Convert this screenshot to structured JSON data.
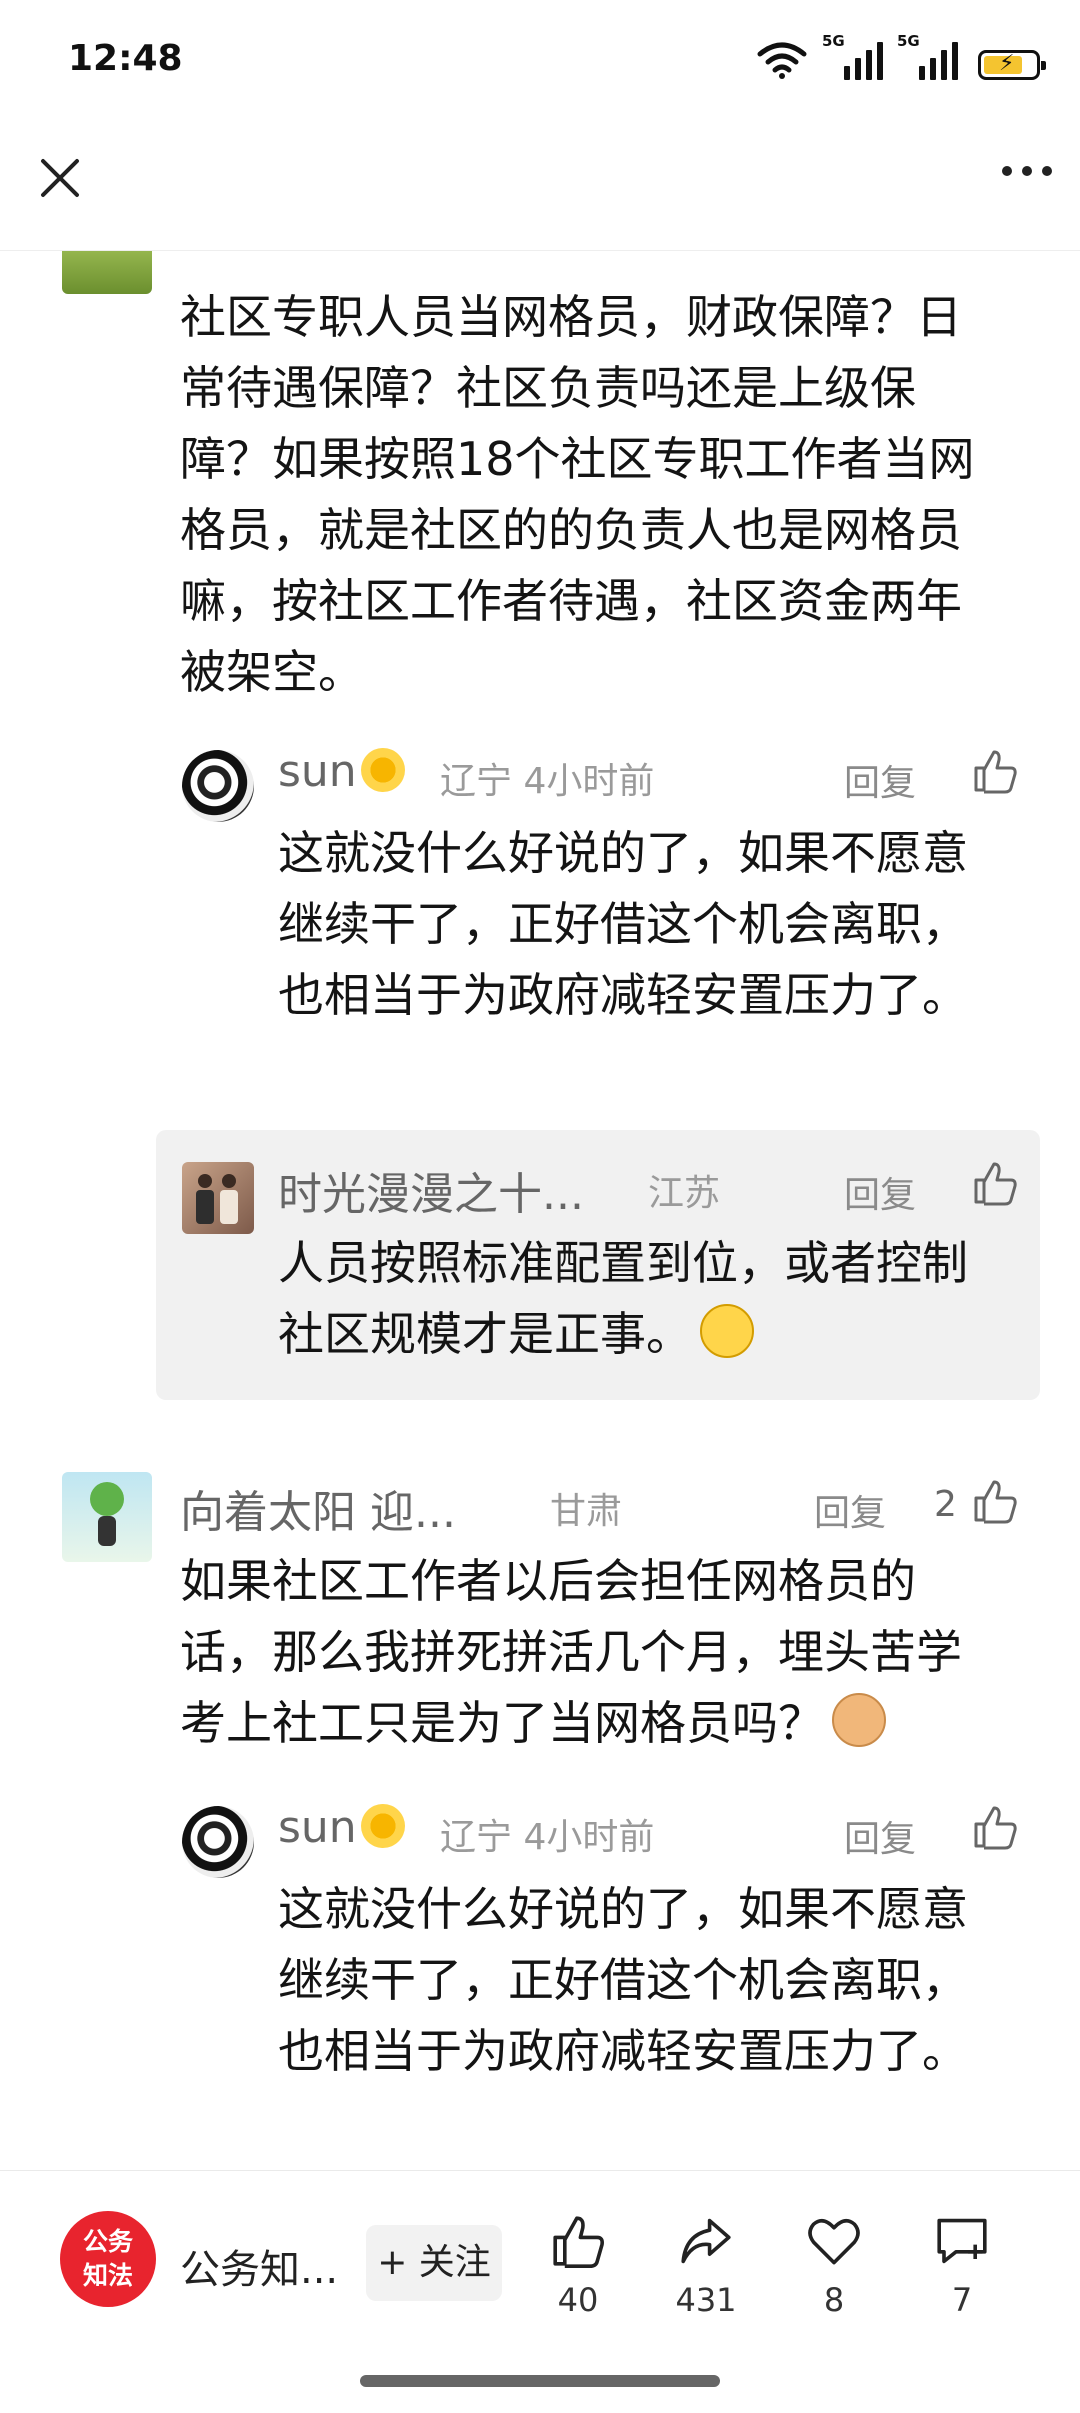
{
  "status_bar": {
    "time": "12:48",
    "net1": "5G",
    "net2": "5G"
  },
  "comments": [
    {
      "text": "社区专职人员当网格员，财政保障？日常待遇保障？社区负责吗还是上级保障？如果按照18个社区专职工作者当网格员，就是社区的的负责人也是网格员嘛，按社区工作者待遇，社区资金两年被架空。",
      "replies": [
        {
          "name": "sun",
          "location": "辽宁",
          "time": "4小时前",
          "reply_label": "回复",
          "text": "这就没什么好说的了，如果不愿意继续干了，正好借这个机会离职，也相当于为政府减轻安置压力了。"
        },
        {
          "name": "时光漫漫之十...",
          "location": "江苏",
          "reply_label": "回复",
          "text": "人员按照标准配置到位，或者控制社区规模才是正事。"
        }
      ]
    },
    {
      "name": "向着太阳  迎...",
      "location": "甘肃",
      "reply_label": "回复",
      "likes": "2",
      "text": "如果社区工作者以后会担任网格员的话，那么我拼死拼活几个月，埋头苦学考上社工只是为了当网格员吗？",
      "replies": [
        {
          "name": "sun",
          "location": "辽宁",
          "time": "4小时前",
          "reply_label": "回复",
          "text": "这就没什么好说的了，如果不愿意继续干了，正好借这个机会离职，也相当于为政府减轻安置压力了。"
        }
      ]
    }
  ],
  "bottom_bar": {
    "publisher_logo": "公务知法",
    "publisher_name": "公务知...",
    "follow_label": "+ 关注",
    "likes": "40",
    "shares": "431",
    "favorites": "8",
    "comments": "7"
  },
  "colors": {
    "accent_red": "#e8242e",
    "quote_bg": "#f1f1f1"
  }
}
